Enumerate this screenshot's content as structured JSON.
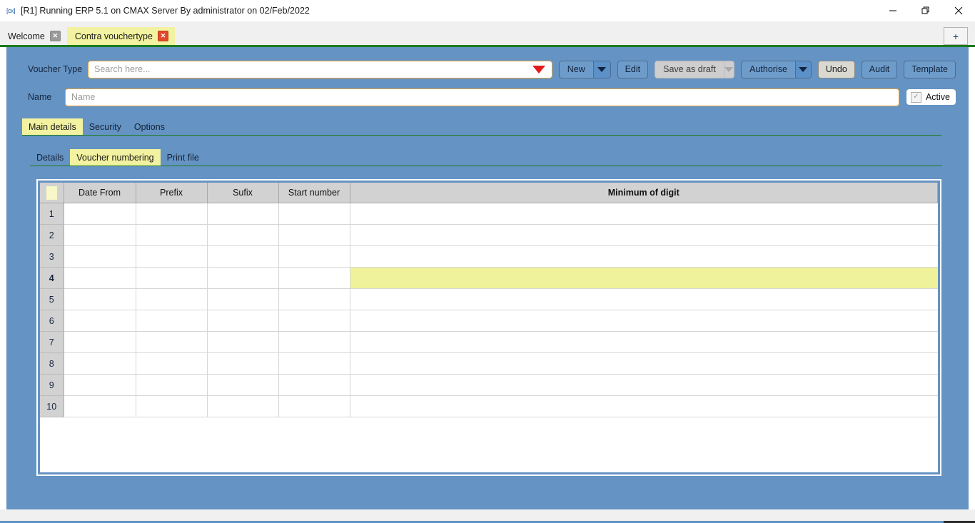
{
  "titlebar": {
    "icon": "app-icon",
    "text": "[R1] Running ERP 5.1 on CMAX Server By administrator on 02/Feb/2022",
    "minimize": "—",
    "maximize": "❐",
    "close": "✕"
  },
  "doc_tabs": {
    "items": [
      {
        "label": "Welcome",
        "active": false,
        "close": "✕"
      },
      {
        "label": "Contra vouchertype",
        "active": true,
        "close": "✕"
      }
    ],
    "add_label": "+"
  },
  "toolbar": {
    "voucher_type_label": "Voucher Type",
    "search_placeholder": "Search here...",
    "search_value": "",
    "new_label": "New",
    "edit_label": "Edit",
    "save_as_draft_label": "Save as draft",
    "authorise_label": "Authorise",
    "undo_label": "Undo",
    "audit_label": "Audit",
    "template_label": "Template"
  },
  "name_row": {
    "label": "Name",
    "placeholder": "Name",
    "value": "",
    "active_label": "Active",
    "active_checked": true,
    "check_glyph": "✓"
  },
  "main_tabs": [
    {
      "label": "Main details",
      "active": true
    },
    {
      "label": "Security",
      "active": false
    },
    {
      "label": "Options",
      "active": false
    }
  ],
  "sub_tabs": [
    {
      "label": "Details",
      "active": false
    },
    {
      "label": "Voucher numbering",
      "active": true
    },
    {
      "label": "Print file",
      "active": false
    }
  ],
  "grid": {
    "columns": [
      "",
      "Date From",
      "Prefix",
      "Sufix",
      "Start number",
      "Minimum of digit"
    ],
    "rows": [
      {
        "n": "1",
        "date_from": "",
        "prefix": "",
        "sufix": "",
        "start_number": "",
        "minimum_of_digit": ""
      },
      {
        "n": "2",
        "date_from": "",
        "prefix": "",
        "sufix": "",
        "start_number": "",
        "minimum_of_digit": ""
      },
      {
        "n": "3",
        "date_from": "",
        "prefix": "",
        "sufix": "",
        "start_number": "",
        "minimum_of_digit": ""
      },
      {
        "n": "4",
        "date_from": "",
        "prefix": "",
        "sufix": "",
        "start_number": "",
        "minimum_of_digit": ""
      },
      {
        "n": "5",
        "date_from": "",
        "prefix": "",
        "sufix": "",
        "start_number": "",
        "minimum_of_digit": ""
      },
      {
        "n": "6",
        "date_from": "",
        "prefix": "",
        "sufix": "",
        "start_number": "",
        "minimum_of_digit": ""
      },
      {
        "n": "7",
        "date_from": "",
        "prefix": "",
        "sufix": "",
        "start_number": "",
        "minimum_of_digit": ""
      },
      {
        "n": "8",
        "date_from": "",
        "prefix": "",
        "sufix": "",
        "start_number": "",
        "minimum_of_digit": ""
      },
      {
        "n": "9",
        "date_from": "",
        "prefix": "",
        "sufix": "",
        "start_number": "",
        "minimum_of_digit": ""
      },
      {
        "n": "10",
        "date_from": "",
        "prefix": "",
        "sufix": "",
        "start_number": "",
        "minimum_of_digit": ""
      }
    ],
    "selected_row_index": 3,
    "highlighted_cell": "minimum_of_digit"
  },
  "colors": {
    "canvas_blue": "#6593c3",
    "tab_active_yellow": "#f2f2a0",
    "tab_underline_green": "#1d7a1d",
    "cell_highlight": "#eff29a",
    "field_border_orange": "#e0a23c",
    "dropdown_red": "#e21b1b",
    "header_grey": "#d2d2d2"
  }
}
